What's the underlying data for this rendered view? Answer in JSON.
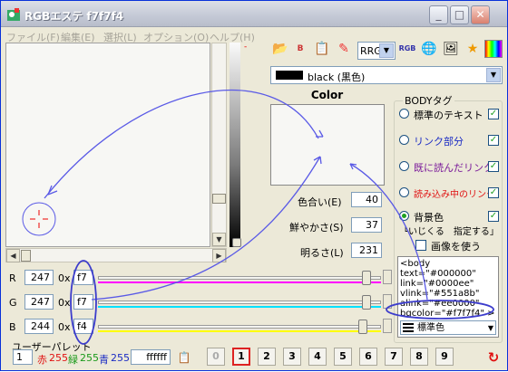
{
  "window": {
    "title": "RGBエステ f7f7f4"
  },
  "menu": [
    "ファイル(F)",
    "編集(E)",
    "選択(L)",
    "オプション(O)",
    "ヘルプ(H)"
  ],
  "toolbar": {
    "mode_select": "RRG",
    "color_name_select": "black  (黒色)"
  },
  "color_panel": {
    "title": "Color",
    "hue_label": "色合い(E)",
    "hue_value": "40",
    "saturation_label": "鮮やかさ(S)",
    "saturation_value": "37",
    "brightness_label": "明るさ(L)",
    "brightness_value": "231"
  },
  "body_tag": {
    "title": "BODYタグ",
    "options": [
      {
        "label": "標準のテキスト",
        "color": "#000000"
      },
      {
        "label": "リンク部分",
        "color": "#1a2bc4"
      },
      {
        "label": "既に読んだリンク",
        "color": "#7a1a9a"
      },
      {
        "label": "読み込み中のリンク",
        "color": "#e01010"
      },
      {
        "label": "背景色",
        "color": "#000000"
      }
    ],
    "bg_note": "└いじくる　指定する」",
    "bg_image": "画像を使う",
    "code_lines": [
      "<body text=\"#000000\"",
      "link=\"#0000ee\"",
      "vlink=\"#551a8b\"",
      "alink=\"#ee0000\"",
      "bgcolor=\"#f7f7f4\" >"
    ],
    "standard_color": "標準色"
  },
  "channels": [
    {
      "name": "R",
      "dec": "247",
      "hex_prefix": "0x",
      "hex": "f7",
      "level": 0.969,
      "color": "#ff00ff"
    },
    {
      "name": "G",
      "dec": "247",
      "hex_prefix": "0x",
      "hex": "f7",
      "level": 0.969,
      "color": "#00e0ff"
    },
    {
      "name": "B",
      "dec": "244",
      "hex_prefix": "0x",
      "hex": "f4",
      "level": 0.957,
      "color": "#ffff00"
    }
  ],
  "palette": {
    "title": "ユーザーパレット",
    "index": "1",
    "red_label": "赤",
    "red_value": "255",
    "green_label": "緑",
    "green_value": "255",
    "blue_label": "青",
    "blue_value": "255",
    "hex": "ffffff",
    "buttons": [
      "0",
      "1",
      "2",
      "3",
      "4",
      "5",
      "6",
      "7",
      "8",
      "9"
    ],
    "selected": "1"
  },
  "colors": {
    "accent_blue": "#5a5ae6",
    "bg": "#f7f7f4"
  }
}
